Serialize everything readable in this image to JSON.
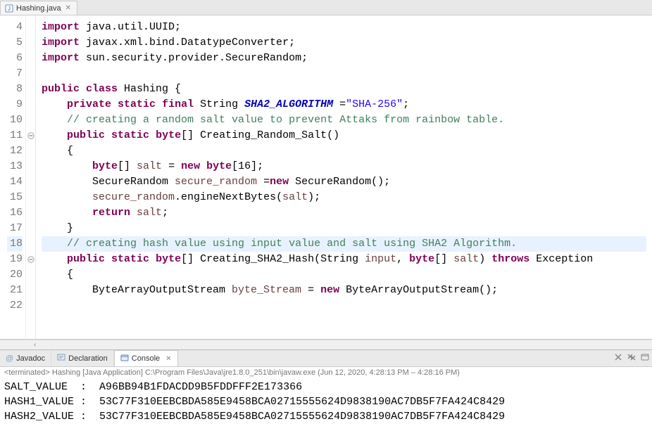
{
  "editor": {
    "tab_title": "Hashing.java",
    "lines": [
      {
        "n": 4,
        "anno": "",
        "tokens": [
          [
            "kw",
            "import"
          ],
          [
            "",
            " java.util.UUID;"
          ]
        ]
      },
      {
        "n": 5,
        "anno": "",
        "tokens": [
          [
            "kw",
            "import"
          ],
          [
            "",
            " javax.xml.bind.DatatypeConverter;"
          ]
        ]
      },
      {
        "n": 6,
        "anno": "",
        "tokens": [
          [
            "kw",
            "import"
          ],
          [
            "",
            " sun.security.provider.SecureRandom;"
          ]
        ]
      },
      {
        "n": 7,
        "anno": "",
        "tokens": [
          [
            "",
            ""
          ]
        ]
      },
      {
        "n": 8,
        "anno": "",
        "tokens": [
          [
            "kw",
            "public"
          ],
          [
            "",
            " "
          ],
          [
            "kw",
            "class"
          ],
          [
            "",
            " Hashing {"
          ]
        ]
      },
      {
        "n": 9,
        "anno": "",
        "tokens": [
          [
            "",
            "    "
          ],
          [
            "kw",
            "private"
          ],
          [
            "",
            " "
          ],
          [
            "kw",
            "static"
          ],
          [
            "",
            " "
          ],
          [
            "kw",
            "final"
          ],
          [
            "",
            " String "
          ],
          [
            "field-static",
            "SHA2_ALGORITHM"
          ],
          [
            "",
            " ="
          ],
          [
            "str",
            "\"SHA-256\""
          ],
          [
            "",
            ";"
          ]
        ]
      },
      {
        "n": 10,
        "anno": "",
        "tokens": [
          [
            "",
            "    "
          ],
          [
            "cmt",
            "// creating a random salt value to prevent Attaks from rainbow table."
          ]
        ]
      },
      {
        "n": 11,
        "anno": "minus",
        "tokens": [
          [
            "",
            "    "
          ],
          [
            "kw",
            "public"
          ],
          [
            "",
            " "
          ],
          [
            "kw",
            "static"
          ],
          [
            "",
            " "
          ],
          [
            "kw",
            "byte"
          ],
          [
            "",
            "[] Creating_Random_Salt()"
          ]
        ]
      },
      {
        "n": 12,
        "anno": "",
        "tokens": [
          [
            "",
            "    {"
          ]
        ]
      },
      {
        "n": 13,
        "anno": "",
        "tokens": [
          [
            "",
            "        "
          ],
          [
            "kw",
            "byte"
          ],
          [
            "",
            "[] "
          ],
          [
            "local",
            "salt"
          ],
          [
            "",
            " = "
          ],
          [
            "kw",
            "new"
          ],
          [
            "",
            " "
          ],
          [
            "kw",
            "byte"
          ],
          [
            "",
            "[16];"
          ]
        ]
      },
      {
        "n": 14,
        "anno": "",
        "tokens": [
          [
            "",
            "        SecureRandom "
          ],
          [
            "local",
            "secure_random"
          ],
          [
            "",
            " ="
          ],
          [
            "kw",
            "new"
          ],
          [
            "",
            " SecureRandom();"
          ]
        ]
      },
      {
        "n": 15,
        "anno": "",
        "tokens": [
          [
            "",
            "        "
          ],
          [
            "local",
            "secure_random"
          ],
          [
            "",
            ".engineNextBytes("
          ],
          [
            "local",
            "salt"
          ],
          [
            "",
            ");"
          ]
        ]
      },
      {
        "n": 16,
        "anno": "",
        "tokens": [
          [
            "",
            "        "
          ],
          [
            "kw",
            "return"
          ],
          [
            "",
            " "
          ],
          [
            "local",
            "salt"
          ],
          [
            "",
            ";"
          ]
        ]
      },
      {
        "n": 17,
        "anno": "",
        "tokens": [
          [
            "",
            "    }"
          ]
        ]
      },
      {
        "n": 18,
        "anno": "",
        "hl": true,
        "tokens": [
          [
            "",
            "    "
          ],
          [
            "cmt",
            "// creating hash value using input value and salt using SHA2 Algorithm."
          ]
        ]
      },
      {
        "n": 19,
        "anno": "minus",
        "tokens": [
          [
            "",
            "    "
          ],
          [
            "kw",
            "public"
          ],
          [
            "",
            " "
          ],
          [
            "kw",
            "static"
          ],
          [
            "",
            " "
          ],
          [
            "kw",
            "byte"
          ],
          [
            "",
            "[] Creating_SHA2_Hash(String "
          ],
          [
            "param",
            "input"
          ],
          [
            "",
            ", "
          ],
          [
            "kw",
            "byte"
          ],
          [
            "",
            "[] "
          ],
          [
            "param",
            "salt"
          ],
          [
            "",
            ") "
          ],
          [
            "kw",
            "throws"
          ],
          [
            "",
            " Exception"
          ]
        ]
      },
      {
        "n": 20,
        "anno": "",
        "tokens": [
          [
            "",
            "    {"
          ]
        ]
      },
      {
        "n": 21,
        "anno": "",
        "tokens": [
          [
            "",
            "        ByteArrayOutputStream "
          ],
          [
            "local",
            "byte_Stream"
          ],
          [
            "",
            " = "
          ],
          [
            "kw",
            "new"
          ],
          [
            "",
            " ByteArrayOutputStream();"
          ]
        ]
      },
      {
        "n": 22,
        "anno": "",
        "tokens": [
          [
            "",
            ""
          ]
        ]
      }
    ]
  },
  "bottom": {
    "tabs": {
      "javadoc": "Javadoc",
      "declaration": "Declaration",
      "console": "Console"
    },
    "console_header": "<terminated> Hashing [Java Application] C:\\Program Files\\Java\\jre1.8.0_251\\bin\\javaw.exe  (Jun 12, 2020, 4:28:13 PM – 4:28:16 PM)",
    "console_lines": [
      "SALT_VALUE  :  A96BB94B1FDACDD9B5FDDFFF2E173366",
      "HASH1_VALUE :  53C77F310EEBCBDA585E9458BCA02715555624D9838190AC7DB5F7FA424C8429",
      "HASH2_VALUE :  53C77F310EEBCBDA585E9458BCA02715555624D9838190AC7DB5F7FA424C8429"
    ]
  }
}
